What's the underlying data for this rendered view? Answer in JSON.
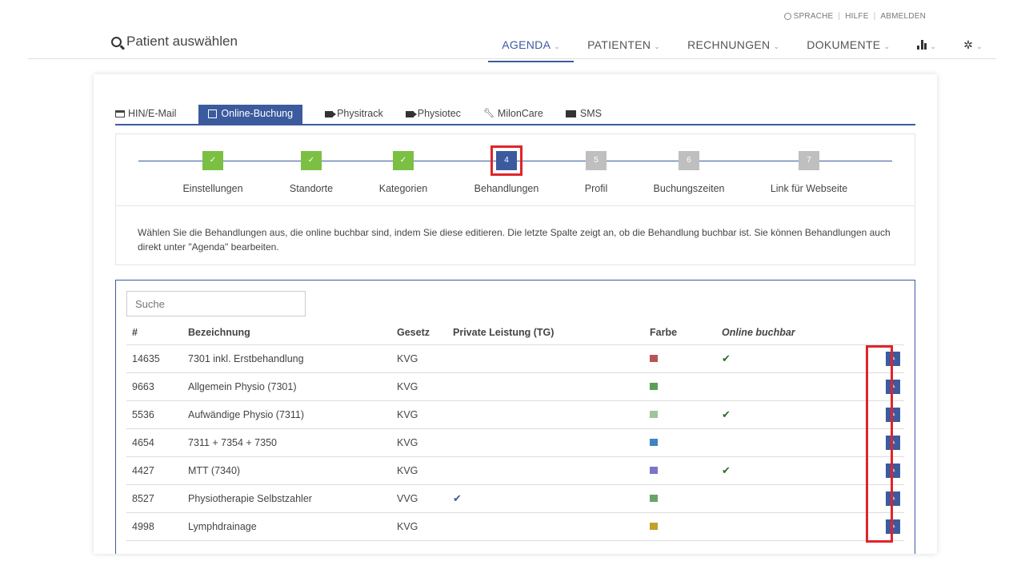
{
  "utility": {
    "sprache": "SPRACHE",
    "hilfe": "HILFE",
    "abmelden": "ABMELDEN"
  },
  "header": {
    "patient_select": "Patient auswählen",
    "nav": [
      {
        "label": "AGENDA"
      },
      {
        "label": "PATIENTEN"
      },
      {
        "label": "RECHNUNGEN"
      },
      {
        "label": "DOKUMENTE"
      }
    ]
  },
  "tabs": [
    {
      "label": "HIN/E-Mail",
      "icon": "card-icon"
    },
    {
      "label": "Online-Buchung",
      "icon": "calendar-check-icon"
    },
    {
      "label": "Physitrack",
      "icon": "video-icon"
    },
    {
      "label": "Physiotec",
      "icon": "video-icon"
    },
    {
      "label": "MilonCare",
      "icon": "wrench-icon"
    },
    {
      "label": "SMS",
      "icon": "envelope-icon"
    }
  ],
  "wizard": {
    "steps": [
      {
        "num": "✓",
        "label": "Einstellungen",
        "state": "done"
      },
      {
        "num": "✓",
        "label": "Standorte",
        "state": "done"
      },
      {
        "num": "✓",
        "label": "Kategorien",
        "state": "done"
      },
      {
        "num": "4",
        "label": "Behandlungen",
        "state": "current"
      },
      {
        "num": "5",
        "label": "Profil",
        "state": "todo"
      },
      {
        "num": "6",
        "label": "Buchungszeiten",
        "state": "todo"
      },
      {
        "num": "7",
        "label": "Link für Webseite",
        "state": "todo"
      }
    ]
  },
  "info_text": "Wählen Sie die Behandlungen aus, die online buchbar sind, indem Sie diese editieren. Die letzte Spalte zeigt an, ob die Behandlung buchbar ist. Sie können Behandlungen auch direkt unter \"Agenda\" bearbeiten.",
  "search": {
    "placeholder": "Suche"
  },
  "table": {
    "headers": [
      "#",
      "Bezeichnung",
      "Gesetz",
      "Private Leistung (TG)",
      "Farbe",
      "Online buchbar"
    ],
    "rows": [
      {
        "id": "14635",
        "name": "7301 inkl. Erstbehandlung",
        "law": "KVG",
        "private": false,
        "color": "#b85454",
        "online": true
      },
      {
        "id": "9663",
        "name": "Allgemein Physio (7301)",
        "law": "KVG",
        "private": false,
        "color": "#5a9e5a",
        "online": false
      },
      {
        "id": "5536",
        "name": "Aufwändige Physio (7311)",
        "law": "KVG",
        "private": false,
        "color": "#9fc49f",
        "online": true
      },
      {
        "id": "4654",
        "name": "7311 + 7354 + 7350",
        "law": "KVG",
        "private": false,
        "color": "#3f84c4",
        "online": false
      },
      {
        "id": "4427",
        "name": "MTT (7340)",
        "law": "KVG",
        "private": false,
        "color": "#7b74c9",
        "online": true
      },
      {
        "id": "8527",
        "name": "Physiotherapie Selbstzahler",
        "law": "VVG",
        "private": true,
        "color": "#6aa36a",
        "online": false
      },
      {
        "id": "4998",
        "name": "Lymphdrainage",
        "law": "KVG",
        "private": false,
        "color": "#c2a02a",
        "online": false
      }
    ]
  }
}
